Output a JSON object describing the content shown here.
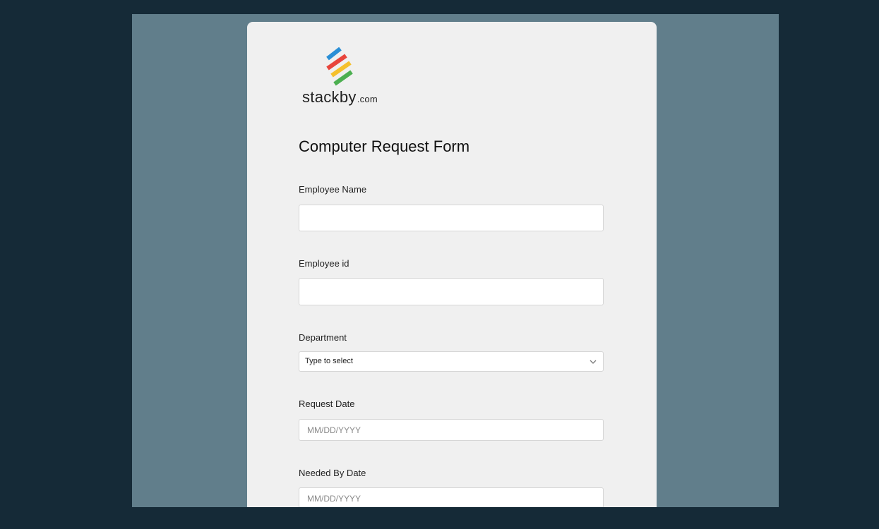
{
  "logo": {
    "name": "stackby",
    "tld": ".com",
    "stripe_colors": [
      "#2a8fd6",
      "#e8453c",
      "#f5c02c",
      "#4caf50"
    ]
  },
  "form": {
    "title": "Computer Request Form",
    "fields": [
      {
        "label": "Employee Name",
        "type": "text",
        "value": "",
        "placeholder": ""
      },
      {
        "label": "Employee id",
        "type": "text",
        "value": "",
        "placeholder": ""
      },
      {
        "label": "Department",
        "type": "select",
        "value": "Type to select"
      },
      {
        "label": "Request Date",
        "type": "date",
        "value": "",
        "placeholder": "MM/DD/YYYY"
      },
      {
        "label": "Needed By Date",
        "type": "date",
        "value": "",
        "placeholder": "MM/DD/YYYY"
      }
    ]
  },
  "colors": {
    "outer_background": "#152a37",
    "page_background": "#617e8b",
    "card_background": "#f0f0f0"
  }
}
